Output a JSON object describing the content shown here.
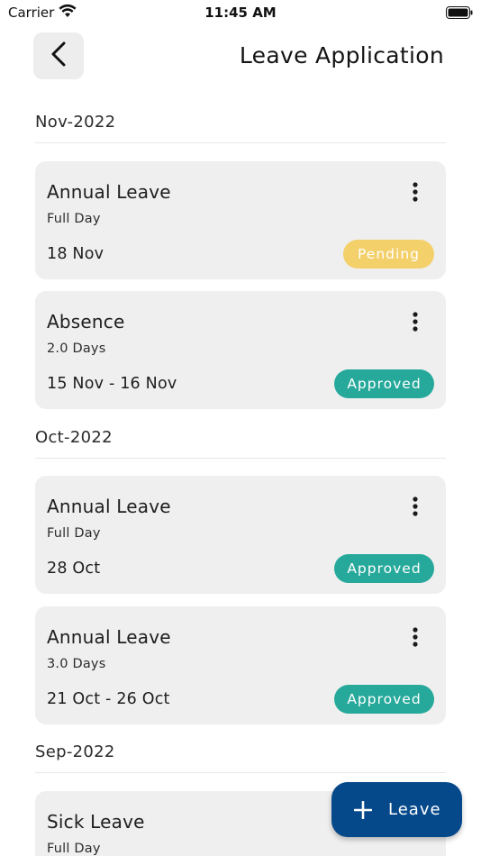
{
  "status_bar": {
    "carrier": "Carrier",
    "time": "11:45 AM",
    "icons": [
      "wifi-icon",
      "battery-icon"
    ]
  },
  "header": {
    "back_icon": "chevron-left-icon",
    "title": "Leave Application"
  },
  "sections": [
    {
      "month": "Nov-2022",
      "items": [
        {
          "type": "Annual Leave",
          "duration": "Full Day",
          "dates": "18 Nov",
          "status": "Pending"
        },
        {
          "type": "Absence",
          "duration": "2.0 Days",
          "dates": "15 Nov - 16 Nov",
          "status": "Approved"
        }
      ]
    },
    {
      "month": "Oct-2022",
      "items": [
        {
          "type": "Annual Leave",
          "duration": "Full Day",
          "dates": "28 Oct",
          "status": "Approved"
        },
        {
          "type": "Annual Leave",
          "duration": "3.0 Days",
          "dates": "21 Oct - 26 Oct",
          "status": "Approved"
        }
      ]
    },
    {
      "month": "Sep-2022",
      "items": [
        {
          "type": "Sick Leave",
          "duration": "Full Day"
        }
      ]
    }
  ],
  "fab": {
    "icon": "plus-icon",
    "label": "Leave"
  },
  "colors": {
    "pending": "#f3d06a",
    "approved": "#26a99b",
    "fab": "#06498b",
    "card_bg": "#efefef"
  }
}
